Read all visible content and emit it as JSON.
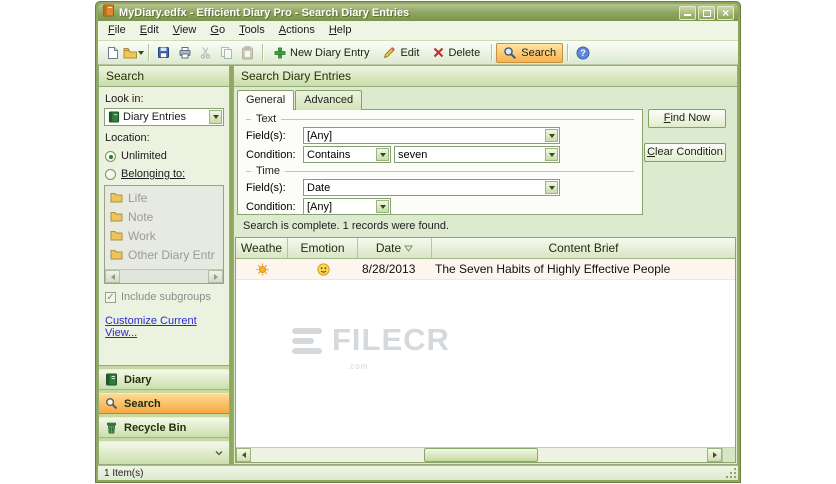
{
  "window": {
    "title": "MyDiary.edfx - Efficient Diary Pro - Search Diary Entries"
  },
  "menu": {
    "items": [
      "File",
      "Edit",
      "View",
      "Go",
      "Tools",
      "Actions",
      "Help"
    ]
  },
  "toolbar": {
    "new_entry": "New Diary Entry",
    "edit": "Edit",
    "delete": "Delete",
    "search": "Search"
  },
  "sidebar": {
    "header": "Search",
    "look_in_label": "Look in:",
    "look_in_value": "Diary Entries",
    "location_label": "Location:",
    "unlimited": "Unlimited",
    "belonging": "Belonging to:",
    "folders": [
      "Life",
      "Note",
      "Work",
      "Other Diary Entr"
    ],
    "include_subgroups": "Include subgroups",
    "customize_view": "Customize Current View...",
    "nav_diary": "Diary",
    "nav_search": "Search",
    "nav_recycle": "Recycle Bin"
  },
  "main": {
    "header": "Search Diary Entries",
    "tab_general": "General",
    "tab_advanced": "Advanced",
    "group_text": {
      "legend": "Text",
      "fields_label": "Field(s):",
      "fields_value": "[Any]",
      "condition_label": "Condition:",
      "condition_value": "Contains",
      "keyword_value": "seven"
    },
    "group_time": {
      "legend": "Time",
      "fields_label": "Field(s):",
      "fields_value": "Date",
      "condition_label": "Condition:",
      "condition_value": "[Any]"
    },
    "result_status": "Search is complete. 1 records were found.",
    "find_now": "Find Now",
    "clear_condition": "Clear Condition",
    "table": {
      "columns": [
        "Weathe",
        "Emotion",
        "Date",
        "Content Brief"
      ],
      "row": {
        "weather_icon": "sun-icon",
        "emotion_icon": "smiley-icon",
        "date": "8/28/2013",
        "content": "The Seven Habits of Highly Effective People"
      }
    }
  },
  "statusbar": {
    "items_count": "1 Item(s)"
  },
  "watermark": {
    "name": "FILECR",
    "domain": ".com"
  },
  "icons": {
    "app": "diary-book",
    "new_note": "document",
    "open": "folder-open",
    "save": "floppy-disk",
    "print": "printer",
    "cut": "scissors",
    "copy": "copy-pages",
    "paste": "clipboard",
    "new_entry": "green-plus",
    "edit": "pencil",
    "delete": "red-x",
    "search": "magnifier",
    "help": "blue-question-circle",
    "look_in": "diary-book",
    "folder": "yellow-folder",
    "nav_diary": "notebook",
    "nav_search": "magnifier",
    "nav_recycle": "recycle-bin",
    "weather": "sun",
    "emotion": "smiley",
    "sort": "sort-descending-triangle"
  },
  "colors": {
    "titlebar_olive": "#8da45e",
    "toolbar_green": "#dcead0",
    "active_orange": "#f9b251",
    "link_blue": "#2b2bcc",
    "row_highlight": "#fcf6ee",
    "watermark_gray": "#ccd0d4"
  }
}
